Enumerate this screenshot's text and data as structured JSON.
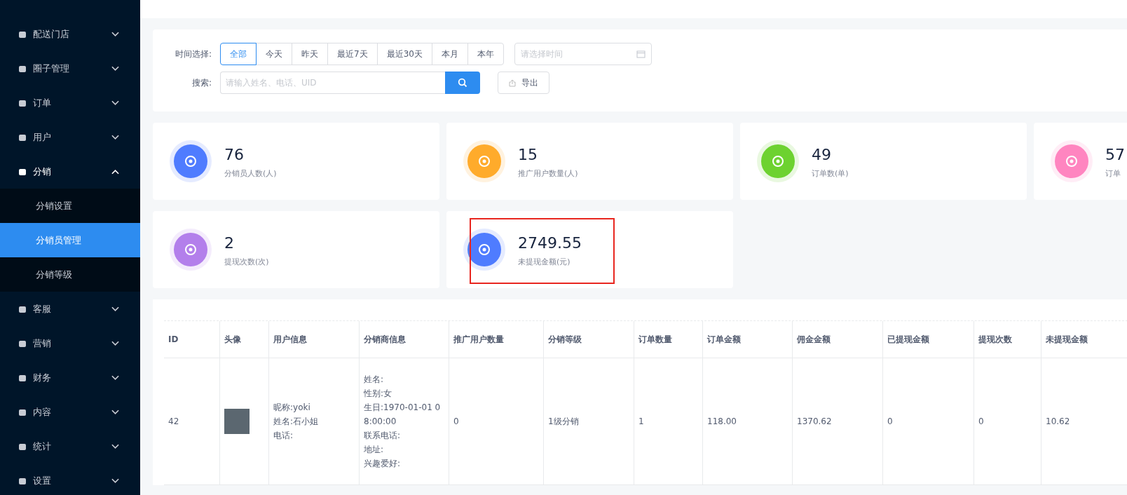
{
  "sidebar": {
    "items": [
      {
        "label": "配送门店",
        "expanded": false
      },
      {
        "label": "圈子管理",
        "expanded": false
      },
      {
        "label": "订单",
        "expanded": false
      },
      {
        "label": "用户",
        "expanded": false
      },
      {
        "label": "分销",
        "expanded": true,
        "children": [
          {
            "label": "分销设置",
            "selected": false
          },
          {
            "label": "分销员管理",
            "selected": true
          },
          {
            "label": "分销等级",
            "selected": false
          }
        ]
      },
      {
        "label": "客服",
        "expanded": false
      },
      {
        "label": "营销",
        "expanded": false
      },
      {
        "label": "财务",
        "expanded": false
      },
      {
        "label": "内容",
        "expanded": false
      },
      {
        "label": "统计",
        "expanded": false
      },
      {
        "label": "设置",
        "expanded": false
      }
    ]
  },
  "filters": {
    "time_label": "时间选择:",
    "time_options": [
      {
        "label": "全部",
        "selected": true
      },
      {
        "label": "今天",
        "selected": false
      },
      {
        "label": "昨天",
        "selected": false
      },
      {
        "label": "最近7天",
        "selected": false
      },
      {
        "label": "最近30天",
        "selected": false
      },
      {
        "label": "本月",
        "selected": false
      },
      {
        "label": "本年",
        "selected": false
      }
    ],
    "date_placeholder": "请选择时间",
    "search_label": "搜索:",
    "search_placeholder": "请输入姓名、电话、UID",
    "export_button": "导出"
  },
  "stats": [
    {
      "value": "76",
      "label": "分销员人数(人)",
      "color": "#4f7cff",
      "highlighted": false
    },
    {
      "value": "15",
      "label": "推广用户数量(人)",
      "color": "#ffab2b",
      "highlighted": false
    },
    {
      "value": "49",
      "label": "订单数(单)",
      "color": "#6dd230",
      "highlighted": false
    },
    {
      "value": "57",
      "label": "订单",
      "color": "#ff85c0",
      "highlighted": false
    },
    {
      "value": "2",
      "label": "提现次数(次)",
      "color": "#b37feb",
      "highlighted": false
    },
    {
      "value": "2749.55",
      "label": "未提现金额(元)",
      "color": "#4f7cff",
      "highlighted": true
    }
  ],
  "table": {
    "columns": [
      "ID",
      "头像",
      "用户信息",
      "分销商信息",
      "推广用户数量",
      "分销等级",
      "订单数量",
      "订单金额",
      "佣金金额",
      "已提现金额",
      "提现次数",
      "未提现金额"
    ],
    "rows": [
      {
        "id": "42",
        "user_info": [
          "昵称:yoki",
          "姓名:石小姐",
          "电话:"
        ],
        "dealer_info": [
          "姓名:",
          "性别:女",
          "生日:1970-01-01 08:00:00",
          "联系电话:",
          "地址:",
          "兴趣爱好:"
        ],
        "promoted_users": "0",
        "level": "1级分销",
        "order_count": "1",
        "order_amount": "118.00",
        "commission": "1370.62",
        "withdrawn": "0",
        "withdraw_count": "0",
        "unwithdrawn": "10.62"
      }
    ]
  }
}
